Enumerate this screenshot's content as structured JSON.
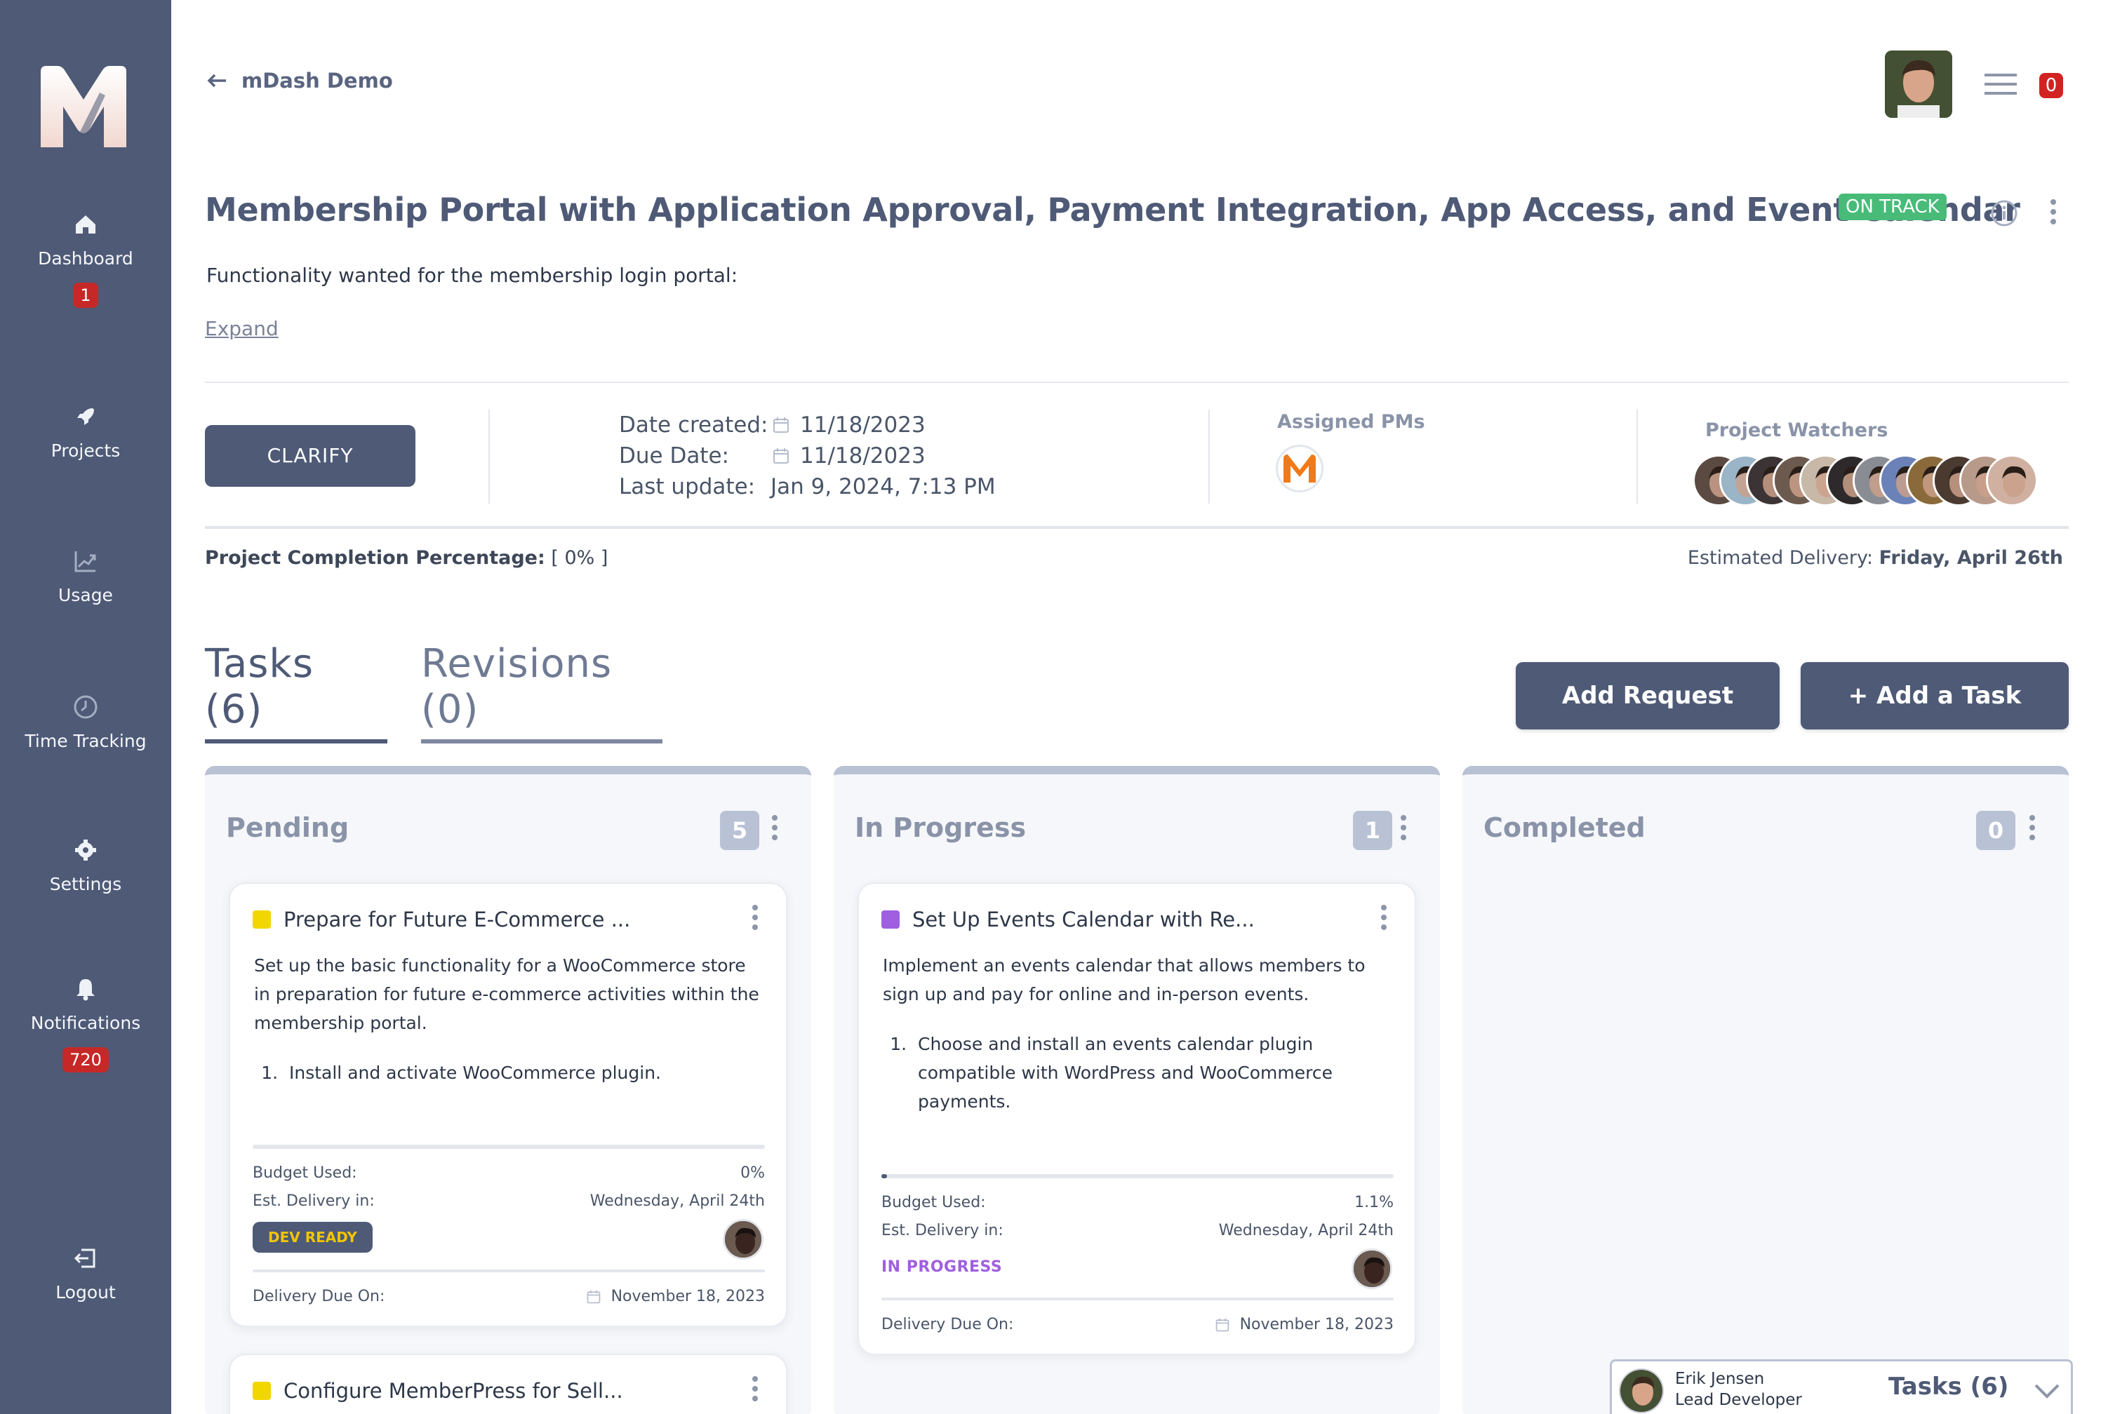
{
  "sidebar": {
    "items": [
      {
        "label": "Dashboard",
        "icon": "home-icon",
        "badge": "1"
      },
      {
        "label": "Projects",
        "icon": "rocket-icon",
        "badge": ""
      },
      {
        "label": "Usage",
        "icon": "chart-icon",
        "badge": ""
      },
      {
        "label": "Time Tracking",
        "icon": "clock-icon",
        "badge": ""
      },
      {
        "label": "Settings",
        "icon": "gear-icon",
        "badge": ""
      },
      {
        "label": "Notifications",
        "icon": "bell-icon",
        "badge": "720"
      },
      {
        "label": "Logout",
        "icon": "logout-icon",
        "badge": ""
      }
    ]
  },
  "header": {
    "back_label": "mDash Demo",
    "notification_count": "0"
  },
  "project": {
    "title": "Membership Portal with Application Approval, Payment Integration, App Access, and Event Calendar",
    "status": "ON TRACK",
    "description": "Functionality wanted for the membership login portal:",
    "expand_label": "Expand",
    "clarify_label": "CLARIFY",
    "date_created_label": "Date created:",
    "date_created": "11/18/2023",
    "due_date_label": "Due Date:",
    "due_date": "11/18/2023",
    "last_update_label": "Last update:",
    "last_update": "Jan 9, 2024, 7:13 PM",
    "assigned_pms_label": "Assigned PMs",
    "watchers_label": "Project Watchers",
    "completion_label": "Project Completion Percentage:",
    "completion_value": "[ 0% ]",
    "est_delivery_label": "Estimated Delivery:",
    "est_delivery_value": "Friday, April 26th"
  },
  "tabs": [
    {
      "label": "Tasks",
      "count": "(6)"
    },
    {
      "label": "Revisions",
      "count": "(0)"
    }
  ],
  "buttons": {
    "add_request": "Add Request",
    "add_task": "+ Add a Task"
  },
  "columns": [
    {
      "title": "Pending",
      "count": "5"
    },
    {
      "title": "In Progress",
      "count": "1"
    },
    {
      "title": "Completed",
      "count": "0"
    }
  ],
  "cards": {
    "pending_1": {
      "title": "Prepare for Future E-Commerce ...",
      "color": "#f2d600",
      "body": "Set up the basic functionality for a WooCommerce store in preparation for future e-commerce activities within the membership portal.",
      "step": "Install and activate WooCommerce plugin.",
      "progress": 0,
      "budget_label": "Budget Used:",
      "budget_value": "0%",
      "est_label": "Est. Delivery in:",
      "est_value": "Wednesday, April 24th",
      "status": "DEV READY",
      "due_label": "Delivery Due On:",
      "due_value": "November 18, 2023"
    },
    "pending_2": {
      "title": "Configure MemberPress for Sell...",
      "color": "#f2d600"
    },
    "progress_1": {
      "title": "Set Up Events Calendar with Re...",
      "color": "#9f5fe0",
      "body": "Implement an events calendar that allows members to sign up and pay for online and in-person events.",
      "step": "Choose and install an events calendar plugin compatible with WordPress and WooCommerce payments.",
      "progress": 0.011,
      "budget_label": "Budget Used:",
      "budget_value": "1.1%",
      "est_label": "Est. Delivery in:",
      "est_value": "Wednesday, April 24th",
      "status": "IN PROGRESS",
      "due_label": "Delivery Due On:",
      "due_value": "November 18, 2023"
    }
  },
  "footer": {
    "name": "Erik Jensen",
    "role": "Lead Developer",
    "tasks_label": "Tasks (6)"
  },
  "colors": {
    "sidebar": "#4e5a76",
    "status_green": "#48bb78",
    "badge_red": "#c62828"
  }
}
